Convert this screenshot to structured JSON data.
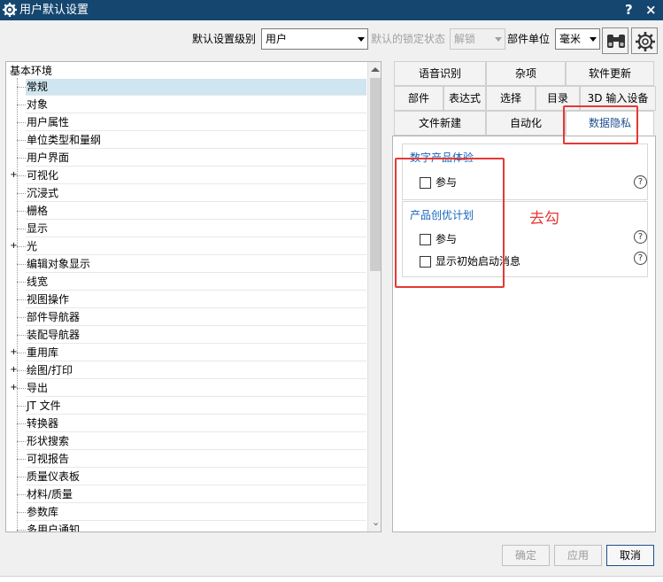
{
  "window": {
    "title": "用户默认设置",
    "help_label": "?",
    "close_label": "×"
  },
  "toolbar": {
    "level_label": "默认设置级别",
    "level_value": "用户",
    "lock_label": "默认的锁定状态",
    "lock_value": "解锁",
    "unit_label": "部件单位",
    "unit_value": "毫米"
  },
  "tree": {
    "root": "基本环境",
    "items": [
      {
        "label": "常规",
        "expandable": false,
        "selected": true
      },
      {
        "label": "对象",
        "expandable": false
      },
      {
        "label": "用户属性",
        "expandable": false
      },
      {
        "label": "单位类型和量纲",
        "expandable": false
      },
      {
        "label": "用户界面",
        "expandable": false
      },
      {
        "label": "可视化",
        "expandable": true
      },
      {
        "label": "沉浸式",
        "expandable": false
      },
      {
        "label": "栅格",
        "expandable": false
      },
      {
        "label": "显示",
        "expandable": false
      },
      {
        "label": "光",
        "expandable": true
      },
      {
        "label": "编辑对象显示",
        "expandable": false
      },
      {
        "label": "线宽",
        "expandable": false
      },
      {
        "label": "视图操作",
        "expandable": false
      },
      {
        "label": "部件导航器",
        "expandable": false
      },
      {
        "label": "装配导航器",
        "expandable": false
      },
      {
        "label": "重用库",
        "expandable": true
      },
      {
        "label": "绘图/打印",
        "expandable": true
      },
      {
        "label": "导出",
        "expandable": true
      },
      {
        "label": "JT 文件",
        "expandable": false
      },
      {
        "label": "转换器",
        "expandable": false
      },
      {
        "label": "形状搜索",
        "expandable": false
      },
      {
        "label": "可视报告",
        "expandable": false
      },
      {
        "label": "质量仪表板",
        "expandable": false
      },
      {
        "label": "材料/质量",
        "expandable": false
      },
      {
        "label": "参数库",
        "expandable": false
      },
      {
        "label": "多用户通知",
        "expandable": false
      }
    ],
    "expand_symbol": "+",
    "scroll_down_symbol": "⌄"
  },
  "tabs": {
    "row1": [
      "语音识别",
      "杂项",
      "软件更新"
    ],
    "row2": [
      "部件",
      "表达式",
      "选择",
      "目录",
      "3D 输入设备"
    ],
    "row3": [
      "文件新建",
      "自动化",
      "数据隐私"
    ],
    "active": "数据隐私"
  },
  "privacy": {
    "group1_title": "数字产品体验",
    "group1_checkbox": "参与",
    "group2_title": "产品创优计划",
    "group2_checkbox1": "参与",
    "group2_checkbox2": "显示初始启动消息",
    "help_symbol": "?"
  },
  "annotation": {
    "text": "去勾",
    "color": "#e53935"
  },
  "buttons": {
    "ok": "确定",
    "apply": "应用",
    "cancel": "取消"
  },
  "colors": {
    "titlebar": "#15466f",
    "selection": "#cfe5ef",
    "group_title": "#1565c0"
  }
}
